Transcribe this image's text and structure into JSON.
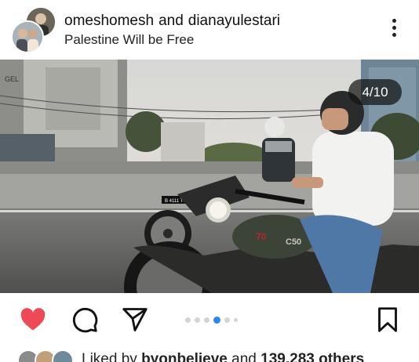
{
  "post": {
    "author_primary": "omeshomesh",
    "connector": "and",
    "author_secondary": "dianayulestari",
    "caption_line": "Palestine Will be Free",
    "photo_counter": "4/10",
    "carousel": {
      "total_visible_dots": 6,
      "active_index": 3
    }
  },
  "photo_text": {
    "building_sign": "GEL",
    "plate_back": "B 4111 TOB",
    "tank_number": "70",
    "tank_badge": "C50"
  },
  "likes": {
    "prefix": "Liked by",
    "user": "byonbelieve",
    "middle": "and",
    "count": "139,283 others"
  },
  "colors": {
    "heart": "#ed4956",
    "active_dot": "#2d86f0",
    "inactive_dot": "#d5d5d5"
  },
  "icons": {
    "like": "heart-icon",
    "comment": "comment-bubble-icon",
    "share": "paper-plane-icon",
    "save": "bookmark-icon",
    "more": "more-vertical-icon"
  }
}
